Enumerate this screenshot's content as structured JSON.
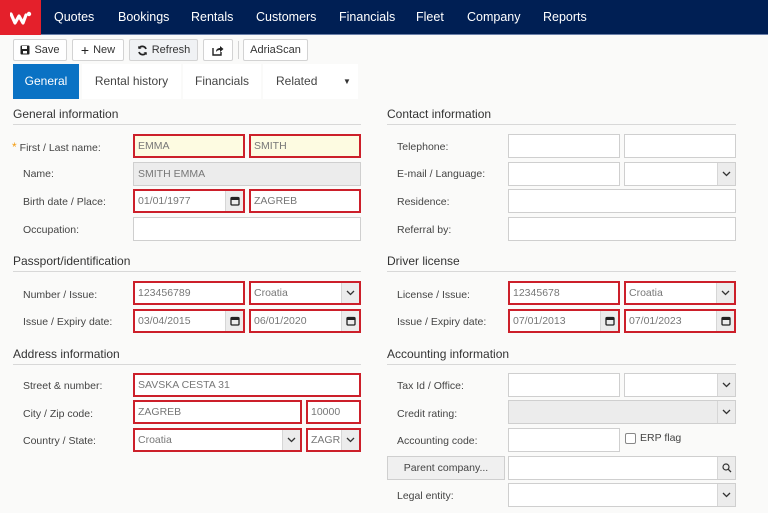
{
  "nav": {
    "items": [
      "Quotes",
      "Bookings",
      "Rentals",
      "Customers",
      "Financials",
      "Fleet",
      "Company",
      "Reports"
    ]
  },
  "toolbar": {
    "save": "Save",
    "new": "New",
    "refresh": "Refresh",
    "adriascan": "AdriaScan"
  },
  "tabs": [
    "General",
    "Rental history",
    "Financials",
    "Related"
  ],
  "general": {
    "title": "General information",
    "first_last_label": "First / Last name:",
    "first_name": "EMMA",
    "last_name": "SMITH",
    "name_label": "Name:",
    "name": "SMITH EMMA",
    "birth_label": "Birth date / Place:",
    "birth_date": "01/01/1977",
    "birth_place": "ZAGREB",
    "occupation_label": "Occupation:",
    "occupation": ""
  },
  "passport": {
    "title": "Passport/identification",
    "number_label": "Number / Issue:",
    "number": "123456789",
    "issue_country": "Croatia",
    "dates_label": "Issue / Expiry date:",
    "issue_date": "03/04/2015",
    "expiry_date": "06/01/2020"
  },
  "address": {
    "title": "Address information",
    "street_label": "Street & number:",
    "street": "SAVSKA CESTA 31",
    "city_label": "City / Zip code:",
    "city": "ZAGREB",
    "zip": "10000",
    "country_label": "Country / State:",
    "country": "Croatia",
    "state": "ZAGREB"
  },
  "contact": {
    "title": "Contact information",
    "telephone_label": "Telephone:",
    "email_label": "E-mail / Language:",
    "residence_label": "Residence:",
    "referral_label": "Referral by:"
  },
  "license": {
    "title": "Driver license",
    "license_label": "License / Issue:",
    "number": "12345678",
    "issue_country": "Croatia",
    "dates_label": "Issue / Expiry date:",
    "issue_date": "07/01/2013",
    "expiry_date": "07/01/2023"
  },
  "accounting": {
    "title": "Accounting information",
    "tax_label": "Tax Id / Office:",
    "credit_label": "Credit rating:",
    "code_label": "Accounting code:",
    "erp_label": "ERP flag",
    "parent_button": "Parent company...",
    "legal_label": "Legal entity:"
  }
}
